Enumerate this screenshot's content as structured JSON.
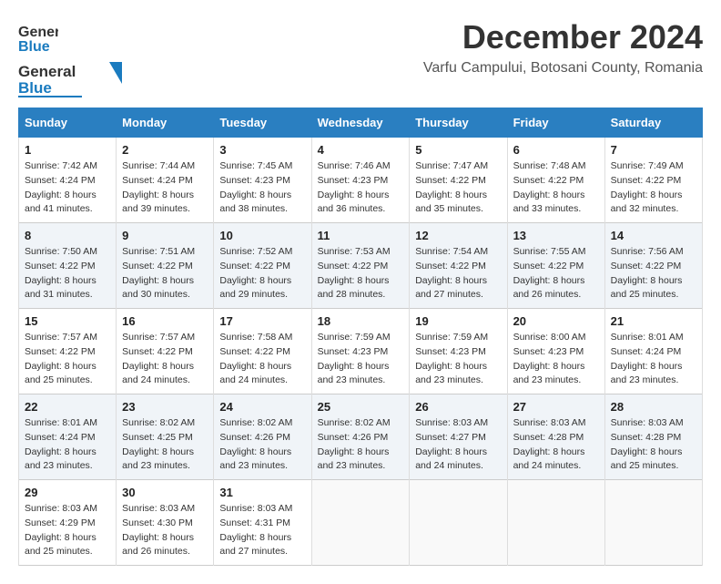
{
  "header": {
    "logo_general": "General",
    "logo_blue": "Blue",
    "title": "December 2024",
    "subtitle": "Varfu Campului, Botosani County, Romania"
  },
  "calendar": {
    "days_of_week": [
      "Sunday",
      "Monday",
      "Tuesday",
      "Wednesday",
      "Thursday",
      "Friday",
      "Saturday"
    ],
    "weeks": [
      [
        {
          "day": "1",
          "sunrise": "7:42 AM",
          "sunset": "4:24 PM",
          "daylight": "8 hours and 41 minutes."
        },
        {
          "day": "2",
          "sunrise": "7:44 AM",
          "sunset": "4:24 PM",
          "daylight": "8 hours and 39 minutes."
        },
        {
          "day": "3",
          "sunrise": "7:45 AM",
          "sunset": "4:23 PM",
          "daylight": "8 hours and 38 minutes."
        },
        {
          "day": "4",
          "sunrise": "7:46 AM",
          "sunset": "4:23 PM",
          "daylight": "8 hours and 36 minutes."
        },
        {
          "day": "5",
          "sunrise": "7:47 AM",
          "sunset": "4:22 PM",
          "daylight": "8 hours and 35 minutes."
        },
        {
          "day": "6",
          "sunrise": "7:48 AM",
          "sunset": "4:22 PM",
          "daylight": "8 hours and 33 minutes."
        },
        {
          "day": "7",
          "sunrise": "7:49 AM",
          "sunset": "4:22 PM",
          "daylight": "8 hours and 32 minutes."
        }
      ],
      [
        {
          "day": "8",
          "sunrise": "7:50 AM",
          "sunset": "4:22 PM",
          "daylight": "8 hours and 31 minutes."
        },
        {
          "day": "9",
          "sunrise": "7:51 AM",
          "sunset": "4:22 PM",
          "daylight": "8 hours and 30 minutes."
        },
        {
          "day": "10",
          "sunrise": "7:52 AM",
          "sunset": "4:22 PM",
          "daylight": "8 hours and 29 minutes."
        },
        {
          "day": "11",
          "sunrise": "7:53 AM",
          "sunset": "4:22 PM",
          "daylight": "8 hours and 28 minutes."
        },
        {
          "day": "12",
          "sunrise": "7:54 AM",
          "sunset": "4:22 PM",
          "daylight": "8 hours and 27 minutes."
        },
        {
          "day": "13",
          "sunrise": "7:55 AM",
          "sunset": "4:22 PM",
          "daylight": "8 hours and 26 minutes."
        },
        {
          "day": "14",
          "sunrise": "7:56 AM",
          "sunset": "4:22 PM",
          "daylight": "8 hours and 25 minutes."
        }
      ],
      [
        {
          "day": "15",
          "sunrise": "7:57 AM",
          "sunset": "4:22 PM",
          "daylight": "8 hours and 25 minutes."
        },
        {
          "day": "16",
          "sunrise": "7:57 AM",
          "sunset": "4:22 PM",
          "daylight": "8 hours and 24 minutes."
        },
        {
          "day": "17",
          "sunrise": "7:58 AM",
          "sunset": "4:22 PM",
          "daylight": "8 hours and 24 minutes."
        },
        {
          "day": "18",
          "sunrise": "7:59 AM",
          "sunset": "4:23 PM",
          "daylight": "8 hours and 23 minutes."
        },
        {
          "day": "19",
          "sunrise": "7:59 AM",
          "sunset": "4:23 PM",
          "daylight": "8 hours and 23 minutes."
        },
        {
          "day": "20",
          "sunrise": "8:00 AM",
          "sunset": "4:23 PM",
          "daylight": "8 hours and 23 minutes."
        },
        {
          "day": "21",
          "sunrise": "8:01 AM",
          "sunset": "4:24 PM",
          "daylight": "8 hours and 23 minutes."
        }
      ],
      [
        {
          "day": "22",
          "sunrise": "8:01 AM",
          "sunset": "4:24 PM",
          "daylight": "8 hours and 23 minutes."
        },
        {
          "day": "23",
          "sunrise": "8:02 AM",
          "sunset": "4:25 PM",
          "daylight": "8 hours and 23 minutes."
        },
        {
          "day": "24",
          "sunrise": "8:02 AM",
          "sunset": "4:26 PM",
          "daylight": "8 hours and 23 minutes."
        },
        {
          "day": "25",
          "sunrise": "8:02 AM",
          "sunset": "4:26 PM",
          "daylight": "8 hours and 23 minutes."
        },
        {
          "day": "26",
          "sunrise": "8:03 AM",
          "sunset": "4:27 PM",
          "daylight": "8 hours and 24 minutes."
        },
        {
          "day": "27",
          "sunrise": "8:03 AM",
          "sunset": "4:28 PM",
          "daylight": "8 hours and 24 minutes."
        },
        {
          "day": "28",
          "sunrise": "8:03 AM",
          "sunset": "4:28 PM",
          "daylight": "8 hours and 25 minutes."
        }
      ],
      [
        {
          "day": "29",
          "sunrise": "8:03 AM",
          "sunset": "4:29 PM",
          "daylight": "8 hours and 25 minutes."
        },
        {
          "day": "30",
          "sunrise": "8:03 AM",
          "sunset": "4:30 PM",
          "daylight": "8 hours and 26 minutes."
        },
        {
          "day": "31",
          "sunrise": "8:03 AM",
          "sunset": "4:31 PM",
          "daylight": "8 hours and 27 minutes."
        },
        null,
        null,
        null,
        null
      ]
    ]
  }
}
